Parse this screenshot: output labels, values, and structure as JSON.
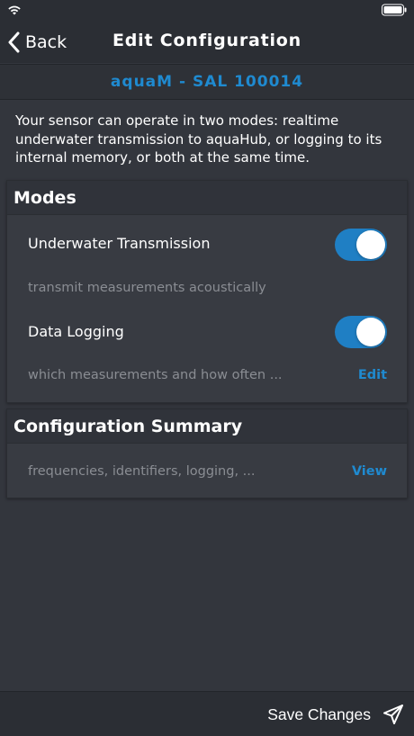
{
  "nav": {
    "back_label": "Back",
    "title": "Edit Configuration"
  },
  "device": {
    "name": "aquaM - SAL 100014"
  },
  "intro": "Your sensor can operate in two modes: realtime underwater transmission to aquaHub, or logging to its internal memory, or both at the same time.",
  "modes": {
    "title": "Modes",
    "transmission": {
      "label": "Underwater Transmission",
      "enabled": true,
      "description": "transmit measurements acoustically"
    },
    "logging": {
      "label": "Data Logging",
      "enabled": true,
      "description": "which measurements and how often ...",
      "action": "Edit"
    }
  },
  "summary": {
    "title": "Configuration Summary",
    "description": "frequencies, identifiers, logging, ...",
    "action": "View"
  },
  "footer": {
    "save_label": "Save Changes"
  },
  "icons": {
    "status_left": "wifi-icon",
    "status_right": "battery-icon",
    "back": "chevron-left-icon",
    "save": "send-icon"
  },
  "colors": {
    "accent": "#1f8ad0",
    "toggle_on": "#1f7fc4",
    "background": "#33363d",
    "bar": "#2b2e34"
  }
}
